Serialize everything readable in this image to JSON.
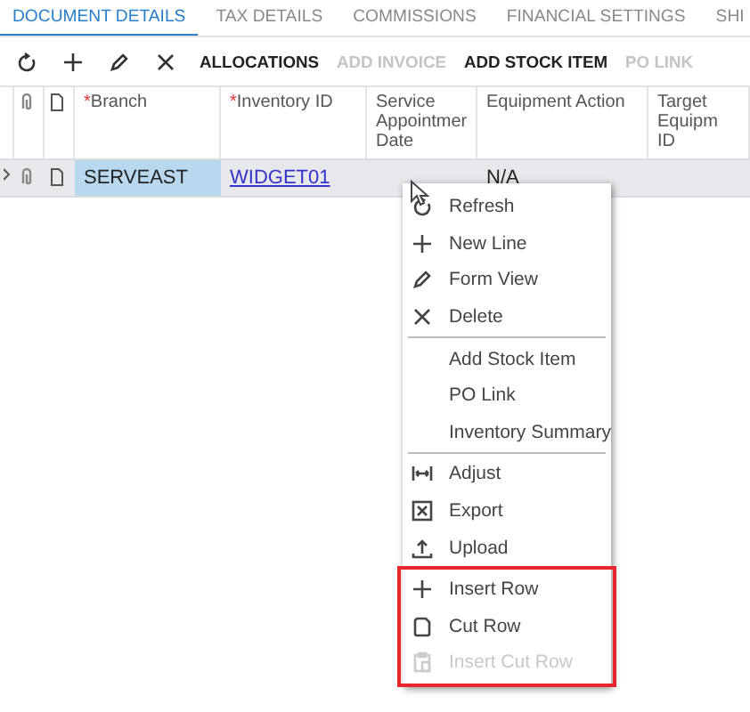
{
  "tabs": [
    {
      "label": "DOCUMENT DETAILS",
      "selected": true
    },
    {
      "label": "TAX DETAILS",
      "selected": false
    },
    {
      "label": "COMMISSIONS",
      "selected": false
    },
    {
      "label": "FINANCIAL SETTINGS",
      "selected": false
    },
    {
      "label": "SHI",
      "selected": false
    }
  ],
  "toolbar": [
    {
      "kind": "refresh",
      "disabled": false
    },
    {
      "kind": "plus",
      "disabled": false
    },
    {
      "kind": "pencil",
      "disabled": false
    },
    {
      "kind": "x",
      "disabled": false
    },
    {
      "kind": "text",
      "label": "ALLOCATIONS",
      "disabled": false
    },
    {
      "kind": "text",
      "label": "ADD INVOICE",
      "disabled": true
    },
    {
      "kind": "text",
      "label": "ADD STOCK ITEM",
      "disabled": false
    },
    {
      "kind": "text",
      "label": "PO LINK",
      "disabled": true
    }
  ],
  "table": {
    "columns": [
      {
        "label": "Branch",
        "marker": "*"
      },
      {
        "label": "Inventory ID",
        "marker": "*"
      },
      {
        "label": "Service\nAppointmer\nDate"
      },
      {
        "label": "Equipment Action"
      },
      {
        "label": "Target Equipm\nID"
      }
    ],
    "rows": [
      {
        "selected": true,
        "cells": [
          {
            "text": "SERVEAST",
            "kind": "active"
          },
          {
            "text": "WIDGET01",
            "kind": "link"
          },
          {
            "text": "",
            "kind": "plain"
          },
          {
            "text": "N/A",
            "kind": "plain"
          },
          {
            "text": "",
            "kind": "plain"
          }
        ]
      }
    ]
  },
  "context_menu": {
    "sections": [
      {
        "items": [
          {
            "label": "Refresh",
            "kind": "refresh",
            "disabled": false
          },
          {
            "label": "New Line",
            "kind": "plus",
            "disabled": false
          },
          {
            "label": "Form View",
            "kind": "pencil",
            "disabled": false
          },
          {
            "label": "Delete",
            "kind": "x",
            "disabled": false
          }
        ]
      },
      {
        "items": [
          {
            "label": "Add Stock Item",
            "kind": "none",
            "disabled": false
          },
          {
            "label": "PO Link",
            "kind": "none",
            "disabled": false
          },
          {
            "label": "Inventory Summary",
            "kind": "none",
            "disabled": false
          }
        ]
      },
      {
        "items": [
          {
            "label": "Adjust",
            "kind": "adjust",
            "disabled": false
          },
          {
            "label": "Export",
            "kind": "excel",
            "disabled": false
          },
          {
            "label": "Upload",
            "kind": "upload",
            "disabled": false
          }
        ]
      },
      {
        "highlighted": true,
        "items": [
          {
            "label": "Insert Row",
            "kind": "plus",
            "disabled": false
          },
          {
            "label": "Cut Row",
            "kind": "cut",
            "disabled": false
          },
          {
            "label": "Insert Cut Row",
            "kind": "paste",
            "disabled": true
          }
        ]
      }
    ]
  }
}
